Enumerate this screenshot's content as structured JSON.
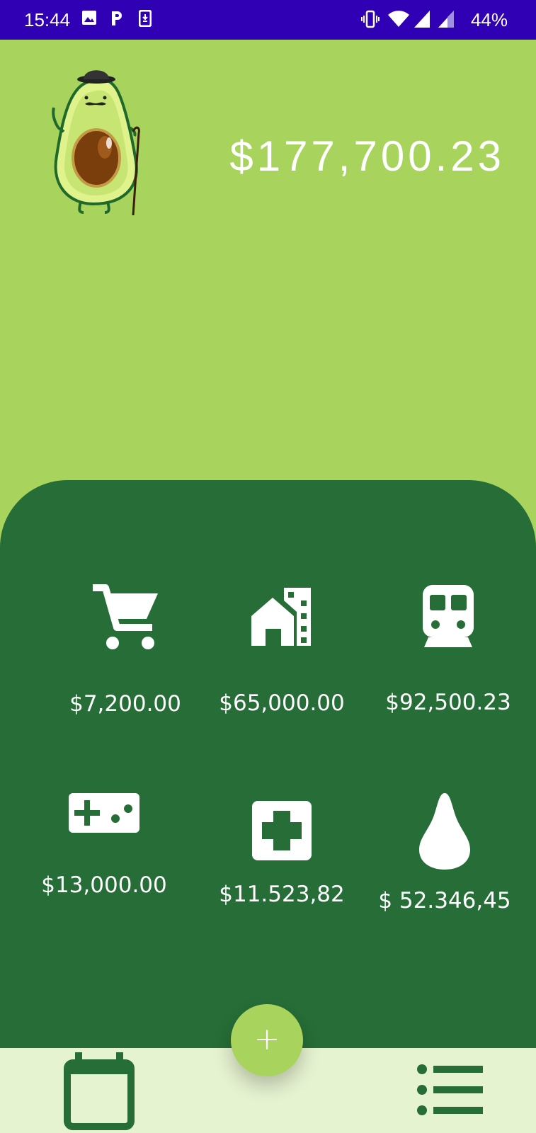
{
  "status_bar": {
    "time": "15:44",
    "battery": "44%",
    "icons": [
      "image-icon",
      "parking-icon",
      "download-icon",
      "vibrate-icon",
      "wifi-icon",
      "signal-icon",
      "signal-icon-2"
    ]
  },
  "header": {
    "total_balance": "$177,700.23",
    "mascot": "avocado-mascot"
  },
  "categories": [
    {
      "icon": "shopping-cart-icon",
      "amount": "$7,200.00"
    },
    {
      "icon": "house-icon",
      "amount": "$65,000.00"
    },
    {
      "icon": "train-icon",
      "amount": "$92,500.23"
    },
    {
      "icon": "gamepad-icon",
      "amount": "$13,000.00"
    },
    {
      "icon": "health-icon",
      "amount": "$11.523,82"
    },
    {
      "icon": "water-drop-icon",
      "amount": "$ 52.346,45"
    }
  ],
  "fab": {
    "label": "+"
  },
  "bottom_nav": {
    "items": [
      "calendar-icon",
      "list-icon"
    ]
  },
  "colors": {
    "status_bar": "#3000b4",
    "background": "#a8d45e",
    "panel": "#266d37",
    "nav": "#e6f3d1",
    "icon_dark": "#266d37"
  }
}
